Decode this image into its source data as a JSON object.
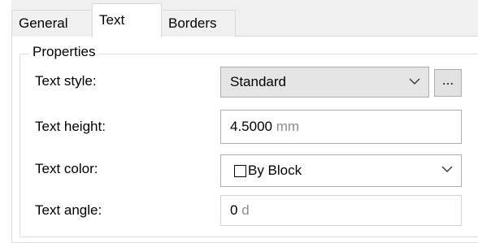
{
  "tabs": [
    {
      "label": "General"
    },
    {
      "label": "Text"
    },
    {
      "label": "Borders"
    }
  ],
  "active_tab": "Text",
  "group": {
    "legend": "Properties"
  },
  "text_style": {
    "label": "Text style:",
    "value": "Standard",
    "browse_label": "..."
  },
  "text_height": {
    "label": "Text height:",
    "value": "4.5000",
    "unit": "mm"
  },
  "text_color": {
    "label": "Text color:",
    "value": "By Block"
  },
  "text_angle": {
    "label": "Text angle:",
    "value": "0",
    "unit": "d"
  }
}
